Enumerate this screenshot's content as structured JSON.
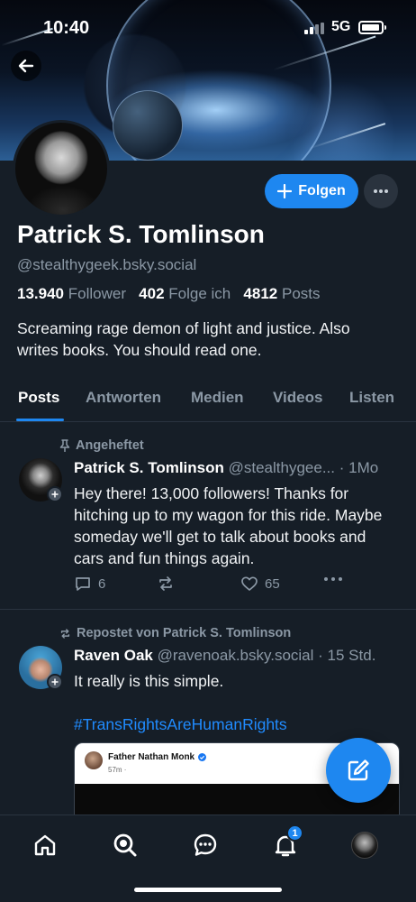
{
  "status_bar": {
    "time": "10:40",
    "network": "5G"
  },
  "profile": {
    "display_name": "Patrick S. Tomlinson",
    "handle": "@stealthygeek.bsky.social",
    "follow_label": "Folgen",
    "followers_count": "13.940",
    "followers_label": "Follower",
    "following_count": "402",
    "following_label": "Folge ich",
    "posts_count": "4812",
    "posts_label": "Posts",
    "bio": "Screaming rage demon of light and justice. Also writes books. You should read one."
  },
  "tabs": [
    {
      "label": "Posts",
      "active": true
    },
    {
      "label": "Antworten",
      "active": false
    },
    {
      "label": "Medien",
      "active": false
    },
    {
      "label": "Videos",
      "active": false
    },
    {
      "label": "Listen",
      "active": false
    }
  ],
  "feed": [
    {
      "context_label": "Angeheftet",
      "author": "Patrick S. Tomlinson",
      "handle": "@stealthygee...",
      "time": "· 1Mo",
      "text": "Hey there! 13,000 followers! Thanks for hitching up to my wagon for this ride. Maybe someday we'll get to talk about books and cars and fun things again.",
      "reply_count": "6",
      "like_count": "65"
    },
    {
      "context_label": "Repostet von Patrick S. Tomlinson",
      "author": "Raven Oak",
      "handle": "@ravenoak.bsky.social",
      "time": "· 15 Std.",
      "text": "It really is this simple.",
      "hashtag": "#TransRightsAreHumanRights",
      "embed": {
        "name": "Father Nathan Monk",
        "time": "57m ·"
      }
    }
  ],
  "bottom_nav": {
    "notification_badge": "1"
  },
  "icons": [
    "back-arrow-icon",
    "plus-icon",
    "more-dots-icon",
    "pin-icon",
    "repost-icon",
    "reply-icon",
    "like-icon",
    "compose-icon",
    "home-icon",
    "search-icon",
    "chat-icon",
    "bell-icon"
  ],
  "colors": {
    "accent": "#1e87f0",
    "background": "#161e27",
    "muted": "#8b98a5",
    "hashtag": "#208bfe"
  }
}
